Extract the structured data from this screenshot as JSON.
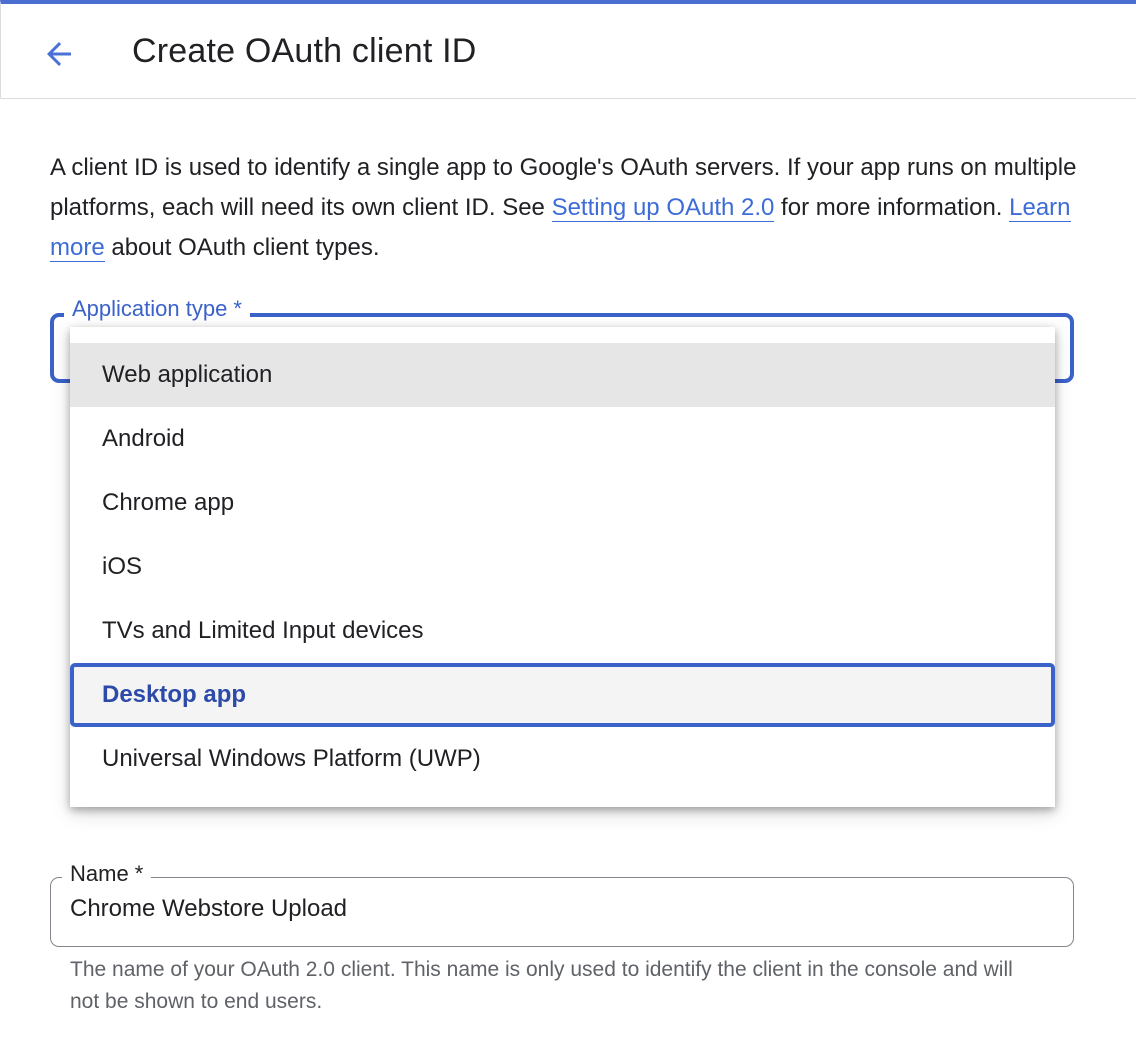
{
  "header": {
    "title": "Create OAuth client ID",
    "back_icon": "arrow-back-icon"
  },
  "intro": {
    "text1": "A client ID is used to identify a single app to Google's OAuth servers. If your app runs on multiple platforms, each will need its own client ID. See ",
    "link1": "Setting up OAuth 2.0",
    "text2": " for more information. ",
    "link2": "Learn more",
    "text3": " about OAuth client types."
  },
  "application_type": {
    "label": "Application type *",
    "options": [
      "Web application",
      "Android",
      "Chrome app",
      "iOS",
      "TVs and Limited Input devices",
      "Desktop app",
      "Universal Windows Platform (UWP)"
    ],
    "hovered_option": "Web application",
    "focused_option": "Desktop app"
  },
  "name_field": {
    "label": "Name *",
    "value": "Chrome Webstore Upload",
    "helper": "The name of your OAuth 2.0 client. This name is only used to identify the client in the console and will not be shown to end users."
  },
  "colors": {
    "accent": "#3b62c9",
    "link": "#3c6cd6",
    "text": "#202124",
    "helper_text": "#5f6368"
  }
}
